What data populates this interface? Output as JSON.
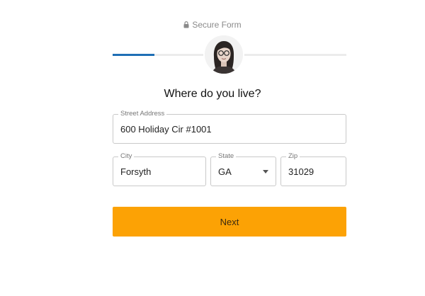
{
  "header": {
    "secure_label": "Secure Form",
    "lock_icon": "lock-icon"
  },
  "progress": {
    "fraction": 0.18,
    "color": "#1f6fb5"
  },
  "avatar": {
    "icon": "person-avatar"
  },
  "question": "Where do you live?",
  "form": {
    "street": {
      "label": "Street Address",
      "value": "600 Holiday Cir #1001"
    },
    "city": {
      "label": "City",
      "value": "Forsyth"
    },
    "state": {
      "label": "State",
      "value": "GA"
    },
    "zip": {
      "label": "Zip",
      "value": "31029"
    }
  },
  "next_button": {
    "label": "Next",
    "color": "#fca205"
  }
}
